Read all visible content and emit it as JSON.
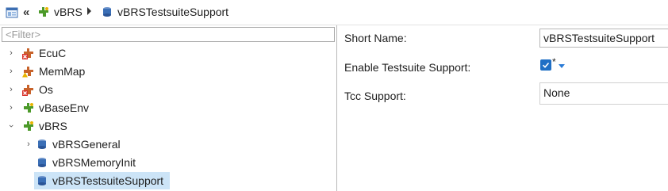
{
  "breadcrumb": {
    "icons": [
      "window-icon",
      "double-chevron-left-icon"
    ],
    "items": [
      {
        "label": "vBRS",
        "icon": "module-icon"
      },
      {
        "label": "vBRSTestsuiteSupport",
        "icon": "container-icon"
      }
    ]
  },
  "tree": {
    "filter_placeholder": "<Filter>",
    "nodes": [
      {
        "label": "EcuC",
        "icon": "module-error-icon",
        "expanded": false
      },
      {
        "label": "MemMap",
        "icon": "module-warning-icon",
        "expanded": false
      },
      {
        "label": "Os",
        "icon": "module-error-icon",
        "expanded": false
      },
      {
        "label": "vBaseEnv",
        "icon": "module-icon",
        "expanded": false
      },
      {
        "label": "vBRS",
        "icon": "module-icon",
        "expanded": true
      },
      {
        "label": "vBRSGeneral",
        "icon": "container-icon",
        "expanded": false
      },
      {
        "label": "vBRSMemoryInit",
        "icon": "container-icon"
      },
      {
        "label": "vBRSTestsuiteSupport",
        "icon": "container-icon",
        "selected": true
      }
    ]
  },
  "form": {
    "short_name_label": "Short Name:",
    "short_name_value": "vBRSTestsuiteSupport",
    "enable_testsuite_label": "Enable Testsuite Support:",
    "enable_testsuite_checked": true,
    "enable_testsuite_marker": "*",
    "tcc_label": "Tcc Support:",
    "tcc_value": "None"
  },
  "colors": {
    "selection": "#cce4f7",
    "checkbox": "#1f6fc5",
    "module_green": "#4c9a2a",
    "error_red": "#d9332b",
    "warning_yellow": "#e8b400",
    "container_blue": "#3b6fb6"
  }
}
